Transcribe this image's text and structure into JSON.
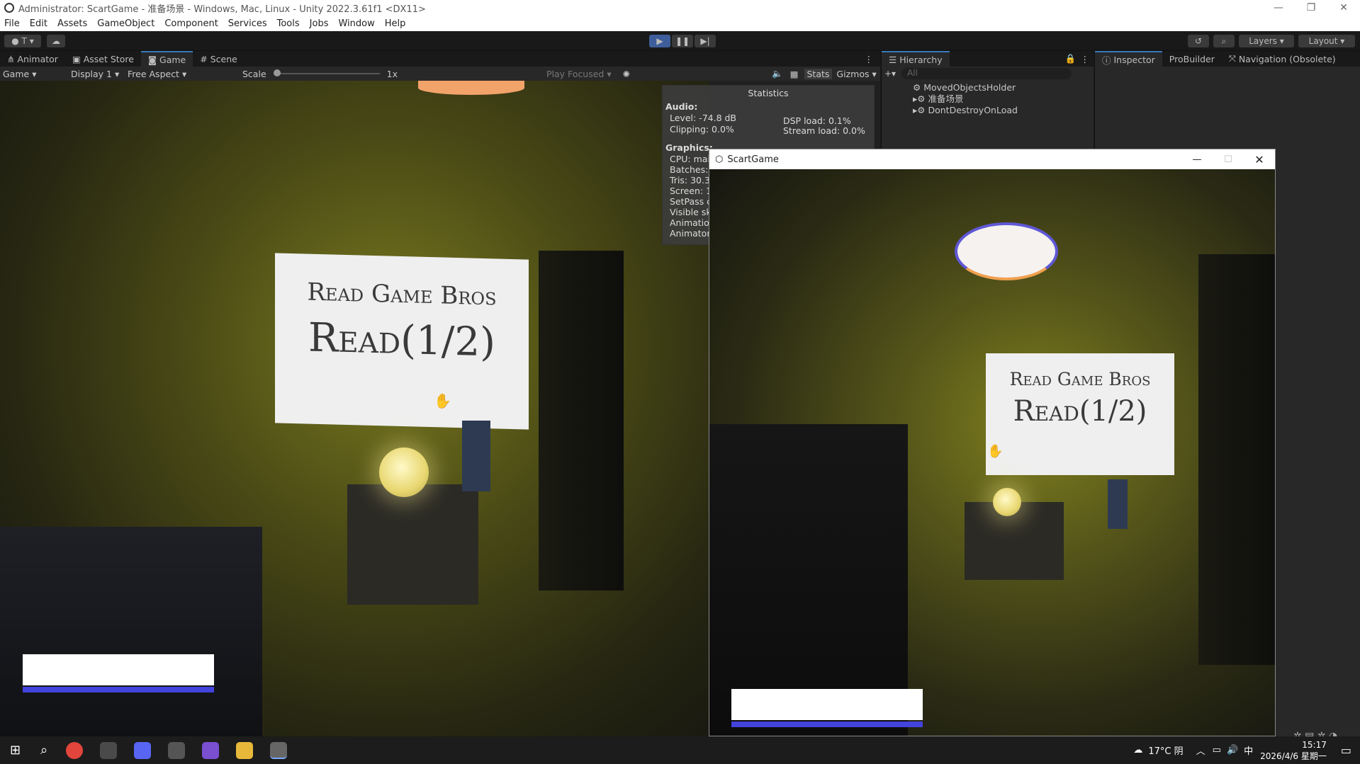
{
  "window": {
    "title": "Administrator: ScartGame - 准备场景 - Windows, Mac, Linux - Unity 2022.3.61f1 <DX11>",
    "controls": [
      "—",
      "❐",
      "✕"
    ]
  },
  "menu": [
    "File",
    "Edit",
    "Assets",
    "GameObject",
    "Component",
    "Services",
    "Tools",
    "Jobs",
    "Window",
    "Help"
  ],
  "toolbar": {
    "account_label": "T",
    "layers_label": "Layers",
    "layout_label": "Layout"
  },
  "game_panel": {
    "tabs": [
      "Animator",
      "Asset Store",
      "Game",
      "Scene"
    ],
    "active_tab": "Game",
    "game_dropdown": "Game",
    "display_dropdown": "Display 1",
    "aspect_dropdown": "Free Aspect",
    "scale_label": "Scale",
    "scale_value": "1x",
    "play_focused": "Play Focused",
    "stats_label": "Stats",
    "gizmos_label": "Gizmos"
  },
  "game_view": {
    "screen_line1": "Read Game Bros",
    "screen_line2": "Read(1/2)"
  },
  "statistics": {
    "title": "Statistics",
    "audio_header": "Audio:",
    "level": "Level: -74.8 dB",
    "clipping": "Clipping: 0.0%",
    "dsp": "DSP load: 0.1%",
    "stream": "Stream load: 0.0%",
    "graphics_header": "Graphics:",
    "graphics_lines": [
      "CPU: mai",
      "Batches:",
      "Tris: 30.3",
      "Screen: 1",
      "SetPass c",
      "Visible sk",
      "Animation",
      "Animator"
    ]
  },
  "hierarchy": {
    "title": "Hierarchy",
    "search_placeholder": "All",
    "items": [
      "MovedObjectsHolder",
      "准备场景",
      "DontDestroyOnLoad"
    ]
  },
  "inspector_tabs": [
    "Inspector",
    "ProBuilder",
    "Navigation (Obsolete)"
  ],
  "float_window": {
    "title": "ScartGame",
    "screen_line1": "Read Game Bros",
    "screen_line2": "Read(1/2)"
  },
  "taskbar": {
    "weather": "17°C 阴",
    "ime": "中",
    "time": "15:17",
    "date": "2026/4/6 星期一"
  },
  "colors": {
    "accent_blue": "#3a79bb",
    "hud_blue": "#4343dd",
    "play_blue": "#3d5e9a"
  }
}
